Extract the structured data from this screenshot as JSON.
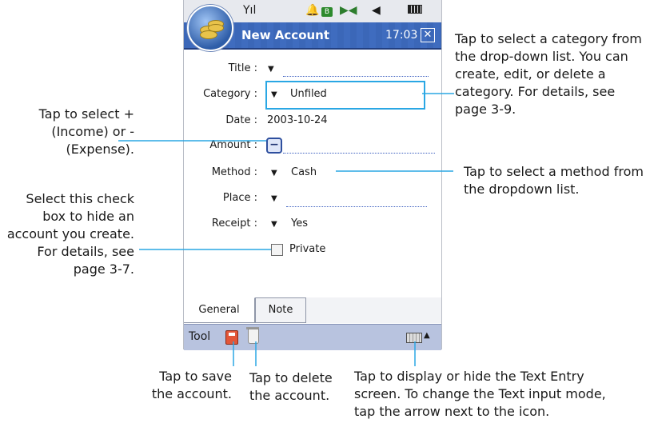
{
  "status_bar": {
    "signal_icon": "signal-icon",
    "alarm_icon": "alarm-icon",
    "sync_icon": "sync-icon",
    "volume_icon": "volume-icon",
    "battery_icon": "battery-icon"
  },
  "header": {
    "title": "New Account",
    "time": "17:03",
    "close": "✕"
  },
  "form": {
    "title_label": "Title :",
    "category_label": "Category :",
    "category_value": "Unfiled",
    "date_label": "Date :",
    "date_value": "2003-10-24",
    "amount_label": "Amount :",
    "amount_sign": "−",
    "method_label": "Method :",
    "method_value": "Cash",
    "place_label": "Place :",
    "receipt_label": "Receipt :",
    "receipt_value": "Yes",
    "private_label": "Private",
    "dropdown_glyph": "▼"
  },
  "tabs": [
    {
      "label": "General"
    },
    {
      "label": "Note"
    }
  ],
  "toolbar": {
    "tool_label": "Tool",
    "arrow": "▲"
  },
  "callouts": {
    "category": "Tap to select a category from the drop-down list. You can create, edit, or delete a category. For details, see page 3-9.",
    "amount": "Tap to select +(Income) or -(Expense).",
    "method": "Tap to select a method from the dropdown list.",
    "private": "Select this check box to hide an account you create. For details, see page 3-7.",
    "save": "Tap to save the account.",
    "delete": "Tap to delete the account.",
    "keyboard": "Tap to display or hide the Text Entry screen. To change the Text input mode, tap the arrow next to the icon."
  },
  "colors": {
    "title_bar": "#3b67b8",
    "highlight": "#2aa7e4",
    "toolbar": "#b8c3df"
  }
}
